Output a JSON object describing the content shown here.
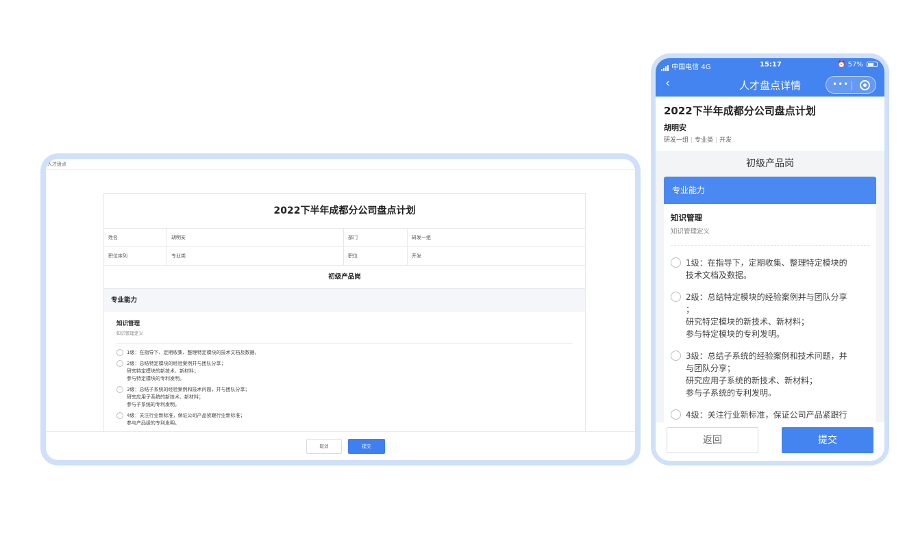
{
  "desktop": {
    "topbar_label": "人才盘点",
    "plan_title": "2022下半年成都分公司盘点计划",
    "info": {
      "name_label": "姓名",
      "name_value": "胡明安",
      "dept_label": "部门",
      "dept_value": "研发一组",
      "seq_label": "职位序列",
      "seq_value": "专业类",
      "pos_label": "职位",
      "pos_value": "开发"
    },
    "position_title": "初级产品岗",
    "section_title": "专业能力",
    "competency": {
      "name": "知识管理",
      "definition": "知识管理定义",
      "options": [
        {
          "lines": [
            "1级：在指导下、定期收集、整理特定模块的技术文档及数据。"
          ]
        },
        {
          "lines": [
            "2级：总结特定模块的经验案例并与团队分享；",
            "研究特定模块的新技术、新材料；",
            "参与特定模块的专利发明。"
          ]
        },
        {
          "lines": [
            "3级：总结子系统的经验案例和技术问题，并与团队分享；",
            "研究应用子系统的新技术、新材料；",
            "参与子系统的专利发明。"
          ]
        },
        {
          "lines": [
            "4级：关注行业新标准，保证公司产品紧跟行业新标准；",
            "参与产品级的专利发明。"
          ]
        }
      ]
    },
    "cancel_label": "取消",
    "submit_label": "提交"
  },
  "mobile": {
    "status": {
      "carrier": "中国电信 4G",
      "time": "15:17",
      "battery": "57%"
    },
    "nav_title": "人才盘点详情",
    "back_glyph": "‹",
    "plan_title": "2022下半年成都分公司盘点计划",
    "employee_name": "胡明安",
    "meta": [
      "研发一组",
      "专业类",
      "开发"
    ],
    "position_title": "初级产品岗",
    "section_title": "专业能力",
    "competency": {
      "name": "知识管理",
      "definition": "知识管理定义",
      "options": [
        {
          "lines": [
            "1级：在指导下，定期收集、整理特定模块的",
            "技术文档及数据。"
          ]
        },
        {
          "lines": [
            "2级：总结特定模块的经验案例并与团队分享",
            "；",
            "研究特定模块的新技术、新材料；",
            "参与特定模块的专利发明。"
          ]
        },
        {
          "lines": [
            "3级：总结子系统的经验案例和技术问题，并",
            "与团队分享；",
            "研究应用子系统的新技术、新材料；",
            "参与子系统的专利发明。"
          ]
        },
        {
          "lines": [
            "4级：关注行业新标准，保证公司产品紧跟行"
          ]
        }
      ]
    },
    "back_label": "返回",
    "submit_label": "提交"
  }
}
